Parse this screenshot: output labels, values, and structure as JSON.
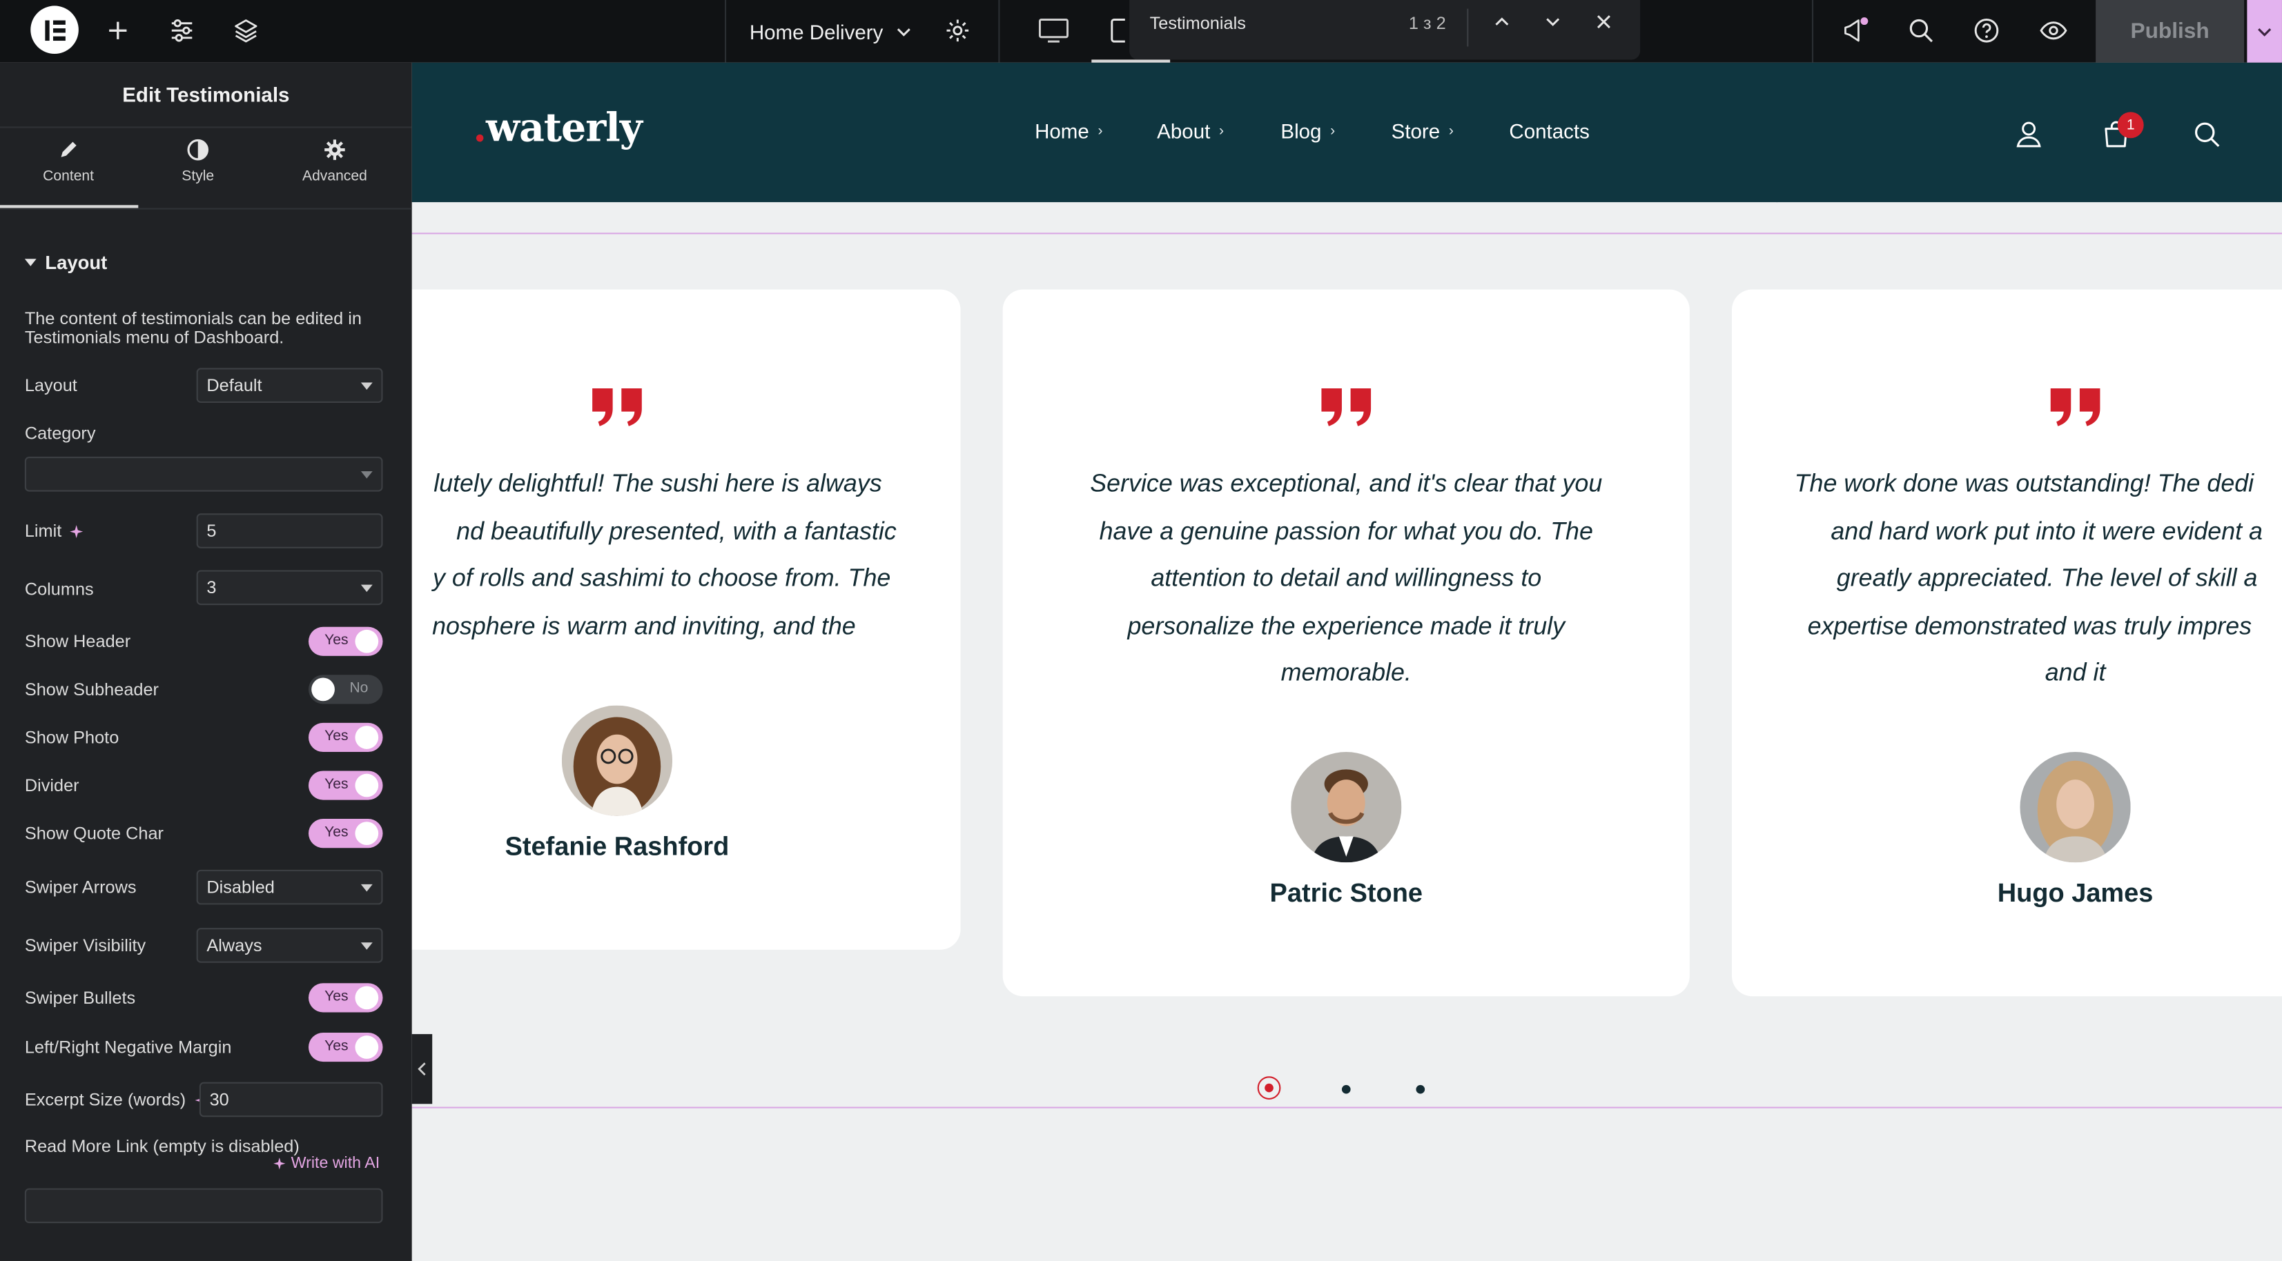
{
  "topbar": {
    "page_name": "Home Delivery",
    "publish_label": "Publish",
    "find": {
      "query": "Testimonials",
      "count": "1 з 2"
    }
  },
  "panel": {
    "title": "Edit Testimonials",
    "tabs": [
      {
        "label": "Content"
      },
      {
        "label": "Style"
      },
      {
        "label": "Advanced"
      }
    ],
    "section_title": "Layout",
    "description": "The content of testimonials can be edited in Testimonials menu of Dashboard.",
    "fields": {
      "layout": {
        "label": "Layout",
        "value": "Default"
      },
      "category": {
        "label": "Category",
        "value": ""
      },
      "limit": {
        "label": "Limit",
        "value": "5"
      },
      "columns": {
        "label": "Columns",
        "value": "3"
      },
      "show_header": {
        "label": "Show Header",
        "value": "Yes"
      },
      "show_subheader": {
        "label": "Show Subheader",
        "value": "No"
      },
      "show_photo": {
        "label": "Show Photo",
        "value": "Yes"
      },
      "divider": {
        "label": "Divider",
        "value": "Yes"
      },
      "show_quote_char": {
        "label": "Show Quote Char",
        "value": "Yes"
      },
      "swiper_arrows": {
        "label": "Swiper Arrows",
        "value": "Disabled"
      },
      "swiper_visibility": {
        "label": "Swiper Visibility",
        "value": "Always"
      },
      "swiper_bullets": {
        "label": "Swiper Bullets",
        "value": "Yes"
      },
      "negative_margin": {
        "label": "Left/Right Negative Margin",
        "value": "Yes"
      },
      "excerpt_size": {
        "label": "Excerpt Size (words)",
        "value": "30"
      },
      "read_more": {
        "label": "Read More Link (empty is disabled)",
        "value": "",
        "ai_label": "Write with AI"
      }
    }
  },
  "site": {
    "logo": {
      "dot": ".",
      "text": "waterly"
    },
    "nav": [
      "Home",
      "About",
      "Blog",
      "Store",
      "Contacts"
    ],
    "nav_chevron": "›",
    "cart_count": "1",
    "testimonials": [
      {
        "lines": [
          "lutely delightful! The sushi here is always",
          "nd beautifully presented, with a fantastic",
          "y of rolls and sashimi to choose from. The",
          "nosphere is warm and inviting, and the"
        ],
        "name": "Stefanie Rashford"
      },
      {
        "lines": [
          "Service was exceptional, and it's clear that you",
          "have a genuine passion for what you do. The",
          "attention to detail and willingness to",
          "personalize the experience made it truly",
          "memorable."
        ],
        "name": "Patric Stone"
      },
      {
        "lines": [
          "The work done was outstanding! The dedi",
          "and hard work put into it were evident a",
          "greatly appreciated. The level of skill a",
          "expertise demonstrated was truly impres",
          "and it"
        ],
        "name": "Hugo James"
      }
    ]
  },
  "colors": {
    "accent_pink": "#e5a6e4",
    "header_bg": "#0f3640",
    "quote_red": "#d21f2b",
    "panel_bg": "#202225"
  },
  "icons": [
    "elementor-logo-icon",
    "plus-icon",
    "sliders-icon",
    "layers-icon",
    "chevron-down-icon",
    "gear-icon",
    "desktop-icon",
    "tablet-icon",
    "chevron-up-icon",
    "close-icon",
    "megaphone-icon",
    "search-icon",
    "help-icon",
    "eye-icon",
    "pencil-icon",
    "contrast-icon",
    "sparkle-icon",
    "user-icon",
    "cart-icon",
    "quote-icon"
  ]
}
